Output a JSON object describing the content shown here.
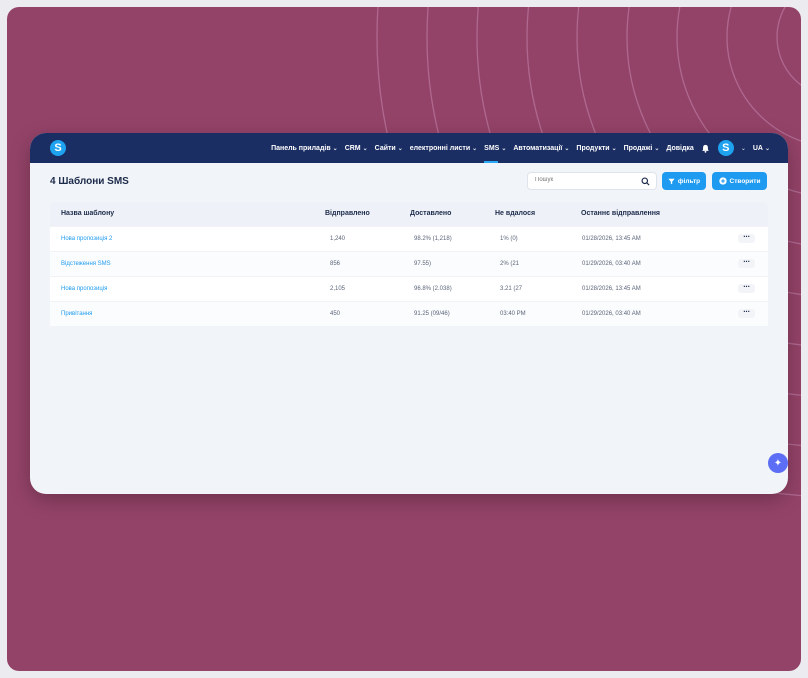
{
  "brand": {
    "logo_letter": "S"
  },
  "nav": {
    "items": [
      {
        "label": "Панель приладів",
        "has_menu": true,
        "active": false
      },
      {
        "label": "CRM",
        "has_menu": true,
        "active": false
      },
      {
        "label": "Сайти",
        "has_menu": true,
        "active": false
      },
      {
        "label": "електронні листи",
        "has_menu": true,
        "active": false
      },
      {
        "label": "SMS",
        "has_menu": true,
        "active": true
      },
      {
        "label": "Автоматизації",
        "has_menu": true,
        "active": false
      },
      {
        "label": "Продукти",
        "has_menu": true,
        "active": false
      },
      {
        "label": "Продажі",
        "has_menu": true,
        "active": false
      },
      {
        "label": "Довідка",
        "has_menu": false,
        "active": false
      }
    ],
    "avatar_letter": "S",
    "language": "UA"
  },
  "page": {
    "title": "4 Шаблони SMS",
    "search_placeholder": "Пошук",
    "filter_label": "фільтр",
    "create_label": "Створити"
  },
  "table": {
    "columns": [
      "Назва шаблону",
      "Відправлено",
      "Доставлено",
      "Не вдалося",
      "Останнє відправлення"
    ],
    "rows": [
      {
        "name": "Нова пропозиція 2",
        "sent": "1,240",
        "delivered": "98.2% (1,218)",
        "failed": "1% (0)",
        "last_sent": "01/28/2026, 13:45 AM"
      },
      {
        "name": "Відстеження SMS",
        "sent": "856",
        "delivered": "97.55)",
        "failed": "2% (21",
        "last_sent": "01/29/2026, 03:40 AM"
      },
      {
        "name": "Нова пропозиція",
        "sent": "2,105",
        "delivered": "96.8% (2.038)",
        "failed": "3.21 (27",
        "last_sent": "01/28/2026, 13:45 AM"
      },
      {
        "name": "Привітання",
        "sent": "450",
        "delivered": "91.25 (09/46)",
        "failed": "03:40 PM",
        "last_sent": "01/29/2026, 03:40 AM"
      }
    ]
  },
  "colors": {
    "accent": "#1e9bf0",
    "topbar": "#1b2e63",
    "background": "#944368",
    "ai_button": "#5b6ef5"
  },
  "icons": {
    "search": "search-icon",
    "filter": "filter-icon",
    "create": "plus-circle-icon",
    "bell": "bell-icon",
    "more": "more-icon",
    "ai": "sparkle-icon"
  }
}
